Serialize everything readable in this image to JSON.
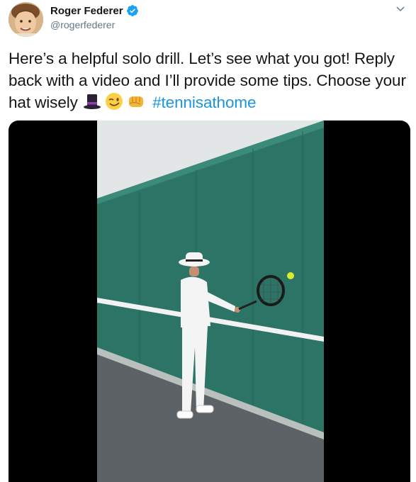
{
  "user": {
    "display_name": "Roger Federer",
    "handle": "@rogerfederer",
    "verified": true,
    "avatar_icon": "profile-photo-child"
  },
  "tweet": {
    "text_main": "Here’s a helpful solo drill. Let’s see what you got! Reply back with a video and I’ll provide some tips. Choose your hat wisely",
    "emojis": [
      "top-hat-emoji",
      "winking-face-emoji",
      "oncoming-fist-emoji"
    ],
    "hashtag": "#tennisathome"
  },
  "media": {
    "type": "video",
    "description_icon": "tennis-wall-drill-video"
  },
  "colors": {
    "hashtag": "#1b95e0",
    "verified": "#1da1f2",
    "handle": "#657786",
    "text": "#14171a"
  }
}
